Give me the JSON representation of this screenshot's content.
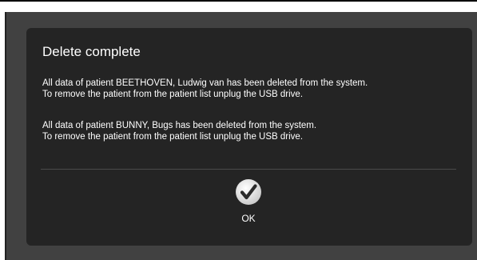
{
  "dialog": {
    "title": "Delete complete",
    "messages": [
      {
        "line1": "All data of patient BEETHOVEN, Ludwig van has been deleted from the system.",
        "line2": "To remove the patient from the patient list unplug the USB drive."
      },
      {
        "line1": "All data of patient BUNNY, Bugs has been deleted from the system.",
        "line2": "To remove the patient from the patient list unplug the USB drive."
      }
    ],
    "ok_button": {
      "label": "OK",
      "icon": "checkmark-icon"
    }
  },
  "colors": {
    "window_background": "#414141",
    "dialog_background": "#242424",
    "text": "#ffffff",
    "icon_circle": "#e6e6e6",
    "icon_check": "#2a2a2a"
  }
}
